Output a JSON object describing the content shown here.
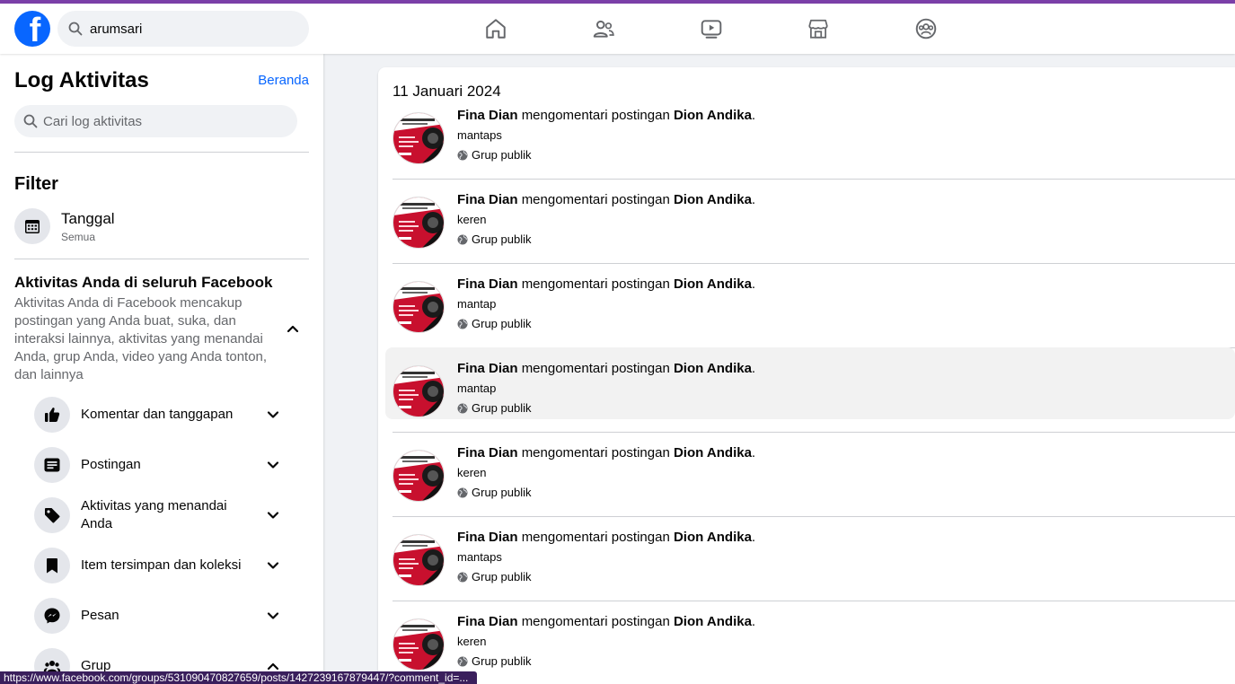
{
  "topbar": {
    "logo": "facebook-logo",
    "search_value": "arumsari",
    "nav": [
      {
        "name": "home-icon"
      },
      {
        "name": "friends-icon"
      },
      {
        "name": "video-icon"
      },
      {
        "name": "marketplace-icon"
      },
      {
        "name": "groups-icon"
      }
    ]
  },
  "sidebar": {
    "title": "Log Aktivitas",
    "home_link": "Beranda",
    "search_placeholder": "Cari log aktivitas",
    "filter_title": "Filter",
    "date_filter": {
      "label": "Tanggal",
      "value": "Semua"
    },
    "activity_title": "Aktivitas Anda di seluruh Facebook",
    "activity_desc": "Aktivitas Anda di Facebook mencakup postingan yang Anda buat, suka, dan interaksi lainnya, aktivitas yang menandai Anda, grup Anda, video yang Anda tonton, dan lainnya",
    "categories": [
      {
        "label": "Komentar dan tanggapan",
        "icon": "thumbs-up-icon"
      },
      {
        "label": "Postingan",
        "icon": "post-icon"
      },
      {
        "label": "Aktivitas yang menandai Anda",
        "icon": "tag-icon"
      },
      {
        "label": "Item tersimpan dan koleksi",
        "icon": "bookmark-icon"
      },
      {
        "label": "Pesan",
        "icon": "messenger-icon"
      },
      {
        "label": "Grup",
        "icon": "groups-icon"
      }
    ]
  },
  "main": {
    "date_heading": "11 Januari 2024",
    "entries": [
      {
        "actor": "Fina Dian",
        "action": "mengomentari postingan",
        "target": "Dion Andika",
        "comment": "mantaps",
        "audience": "Grup publik"
      },
      {
        "actor": "Fina Dian",
        "action": "mengomentari postingan",
        "target": "Dion Andika",
        "comment": "keren",
        "audience": "Grup publik"
      },
      {
        "actor": "Fina Dian",
        "action": "mengomentari postingan",
        "target": "Dion Andika",
        "comment": "mantap",
        "audience": "Grup publik"
      },
      {
        "actor": "Fina Dian",
        "action": "mengomentari postingan",
        "target": "Dion Andika",
        "comment": "mantap",
        "audience": "Grup publik"
      },
      {
        "actor": "Fina Dian",
        "action": "mengomentari postingan",
        "target": "Dion Andika",
        "comment": "keren",
        "audience": "Grup publik"
      },
      {
        "actor": "Fina Dian",
        "action": "mengomentari postingan",
        "target": "Dion Andika",
        "comment": "mantaps",
        "audience": "Grup publik"
      },
      {
        "actor": "Fina Dian",
        "action": "mengomentari postingan",
        "target": "Dion Andika",
        "comment": "keren",
        "audience": "Grup publik"
      }
    ]
  },
  "status_url": "https://www.facebook.com/groups/531090470827659/posts/1427239167879447/?comment_id=...",
  "colors": {
    "brand": "#0866ff",
    "accent_bar": "#7b3fa8"
  }
}
